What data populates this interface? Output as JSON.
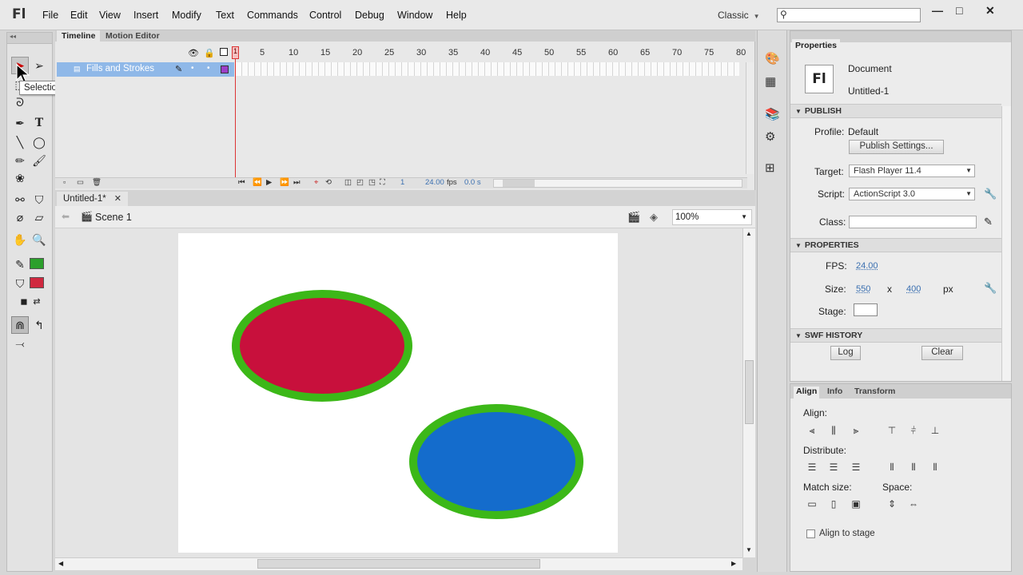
{
  "app": {
    "logo": "Fl"
  },
  "menu": [
    "File",
    "Edit",
    "View",
    "Insert",
    "Modify",
    "Text",
    "Commands",
    "Control",
    "Debug",
    "Window",
    "Help"
  ],
  "workspace": "Classic",
  "window_controls": {
    "minimize": "—",
    "maximize": "□",
    "close": "✕"
  },
  "tools": {
    "tooltip": "Selection Tool (V)"
  },
  "timeline": {
    "tabs": [
      "Timeline",
      "Motion Editor"
    ],
    "ruler": [
      "1",
      "5",
      "10",
      "15",
      "20",
      "25",
      "30",
      "35",
      "40",
      "45",
      "50",
      "55",
      "60",
      "65",
      "70",
      "75",
      "80"
    ],
    "layer_name": "Fills and Strokes",
    "current_frame": "1",
    "fps": "24.00",
    "fps_unit": "fps",
    "time": "0.0 s"
  },
  "document": {
    "tab_label": "Untitled-1*",
    "scene": "Scene 1",
    "zoom": "100%"
  },
  "colors": {
    "stroke_swatch": "#2ca02c",
    "fill_swatch": "#d0283f",
    "ellipse_stroke": "#3cb818",
    "ellipse1_fill": "#c8103c",
    "ellipse2_fill": "#146ccc"
  },
  "properties": {
    "tab": "Properties",
    "doc_icon": "Fl",
    "type": "Document",
    "name": "Untitled-1",
    "publish_header": "PUBLISH",
    "profile_label": "Profile:",
    "profile_value": "Default",
    "publish_settings_btn": "Publish Settings...",
    "target_label": "Target:",
    "target_value": "Flash Player 11.4",
    "script_label": "Script:",
    "script_value": "ActionScript 3.0",
    "class_label": "Class:",
    "properties_header": "PROPERTIES",
    "fps_label": "FPS:",
    "fps_value": "24.00",
    "size_label": "Size:",
    "width": "550",
    "x": "x",
    "height": "400",
    "unit": "px",
    "stage_label": "Stage:",
    "swf_header": "SWF HISTORY",
    "log_btn": "Log",
    "clear_btn": "Clear"
  },
  "align_panel": {
    "tabs": [
      "Align",
      "Info",
      "Transform"
    ],
    "align_label": "Align:",
    "distribute_label": "Distribute:",
    "match_label": "Match size:",
    "space_label": "Space:",
    "stage_label": "Align to stage"
  }
}
